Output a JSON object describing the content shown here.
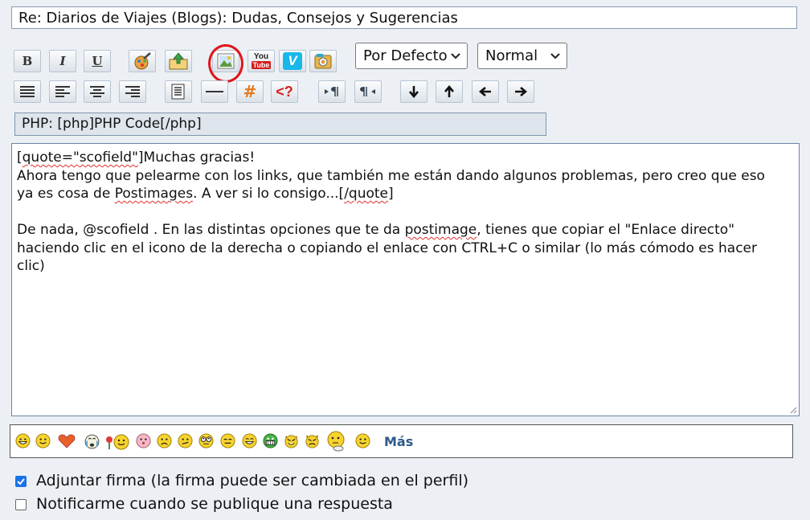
{
  "subject": {
    "value": "Re: Diarios de Viajes (Blogs): Dudas, Consejos y Sugerencias"
  },
  "toolbar": {
    "bold_label": "B",
    "italic_label": "I",
    "underline_label": "U",
    "youtube_label_top": "You",
    "youtube_label_bottom": "Tube",
    "vimeo_label": "V",
    "hash_label": "#",
    "code_label": "<?"
  },
  "selects": {
    "font_value": "Por Defecto",
    "size_value": "Normal"
  },
  "help_line": "PHP: [php]PHP Code[/php]",
  "editor": {
    "line1_a": "[",
    "line1_b": "quote=\"scofield\"",
    "line1_c": "]Muchas gracias!",
    "line2": "Ahora tengo que pelearme con los links, que también me están dando algunos problemas, pero creo que eso",
    "line3_a": "ya es cosa de ",
    "line3_b": "Postimages",
    "line3_c": ". A ver si lo consigo...[",
    "line3_d": "/quote",
    "line3_e": "]",
    "line5_a": "De nada, @scofield . En las distintas opciones que te da ",
    "line5_b": "postimage",
    "line5_c": ", tienes que copiar el \"Enlace directo\"",
    "line6": "haciendo clic en el icono de la derecha o copiando el enlace con CTRL+C o similar (lo más cómodo es hacer",
    "line7": "clic)"
  },
  "smileys": {
    "more_label": "Más"
  },
  "options": {
    "attach_signature_label": "Adjuntar firma (la firma puede ser cambiada en el perfil)",
    "attach_signature_checked": true,
    "notify_label": "Notificarme cuando se publique una respuesta",
    "notify_checked": false
  },
  "colors": {
    "accent": "#1a73e8",
    "annotation": "#e0151b",
    "link": "#2f5a8a"
  }
}
